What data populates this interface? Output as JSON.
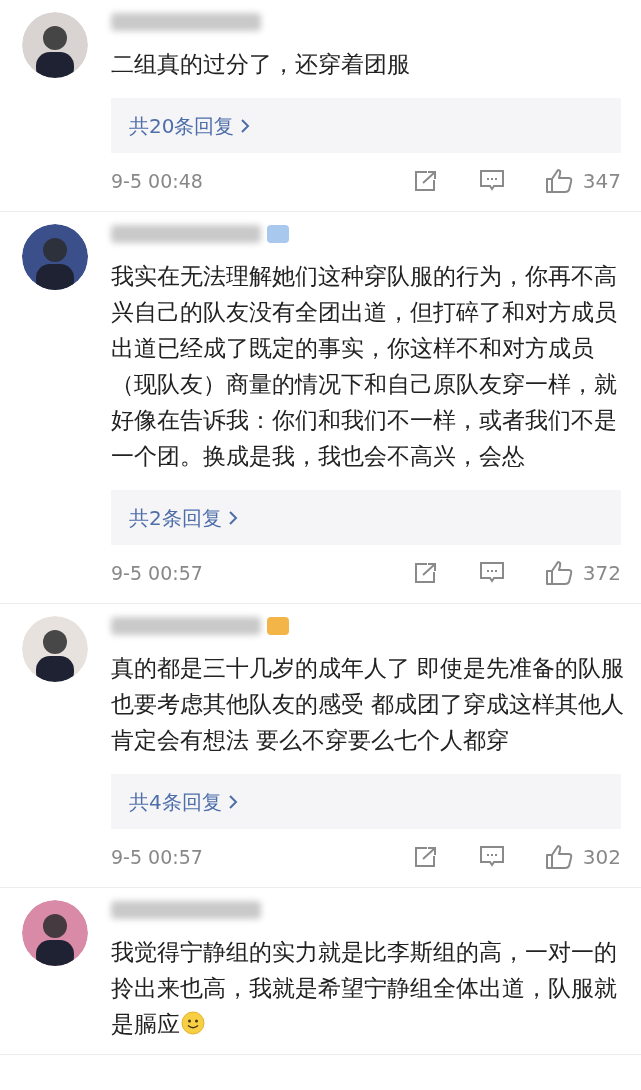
{
  "comments": [
    {
      "text": "二组真的过分了，还穿着团服",
      "replies": "共20条回复",
      "time": "9-5 00:48",
      "likes": "347"
    },
    {
      "badge": {
        "color": "#a9c8ee"
      },
      "text": "我实在无法理解她们这种穿队服的行为，你再不高兴自己的队友没有全团出道，但打碎了和对方成员出道已经成了既定的事实，你这样不和对方成员（现队友）商量的情况下和自己原队友穿一样，就好像在告诉我：你们和我们不一样，或者我们不是一个团。换成是我，我也会不高兴，会怂",
      "replies": "共2条回复",
      "time": "9-5 00:57",
      "likes": "372"
    },
    {
      "badge": {
        "color": "#f3b548"
      },
      "text": "真的都是三十几岁的成年人了 即使是先准备的队服也要考虑其他队友的感受 都成团了穿成这样其他人肯定会有想法 要么不穿要么七个人都穿",
      "replies": "共4条回复",
      "time": "9-5 00:57",
      "likes": "302"
    },
    {
      "text": "我觉得宁静组的实力就是比李斯组的高，一对一的拎出来也高，我就是希望宁静组全体出道，队服就是膈应",
      "emoji": true
    }
  ]
}
